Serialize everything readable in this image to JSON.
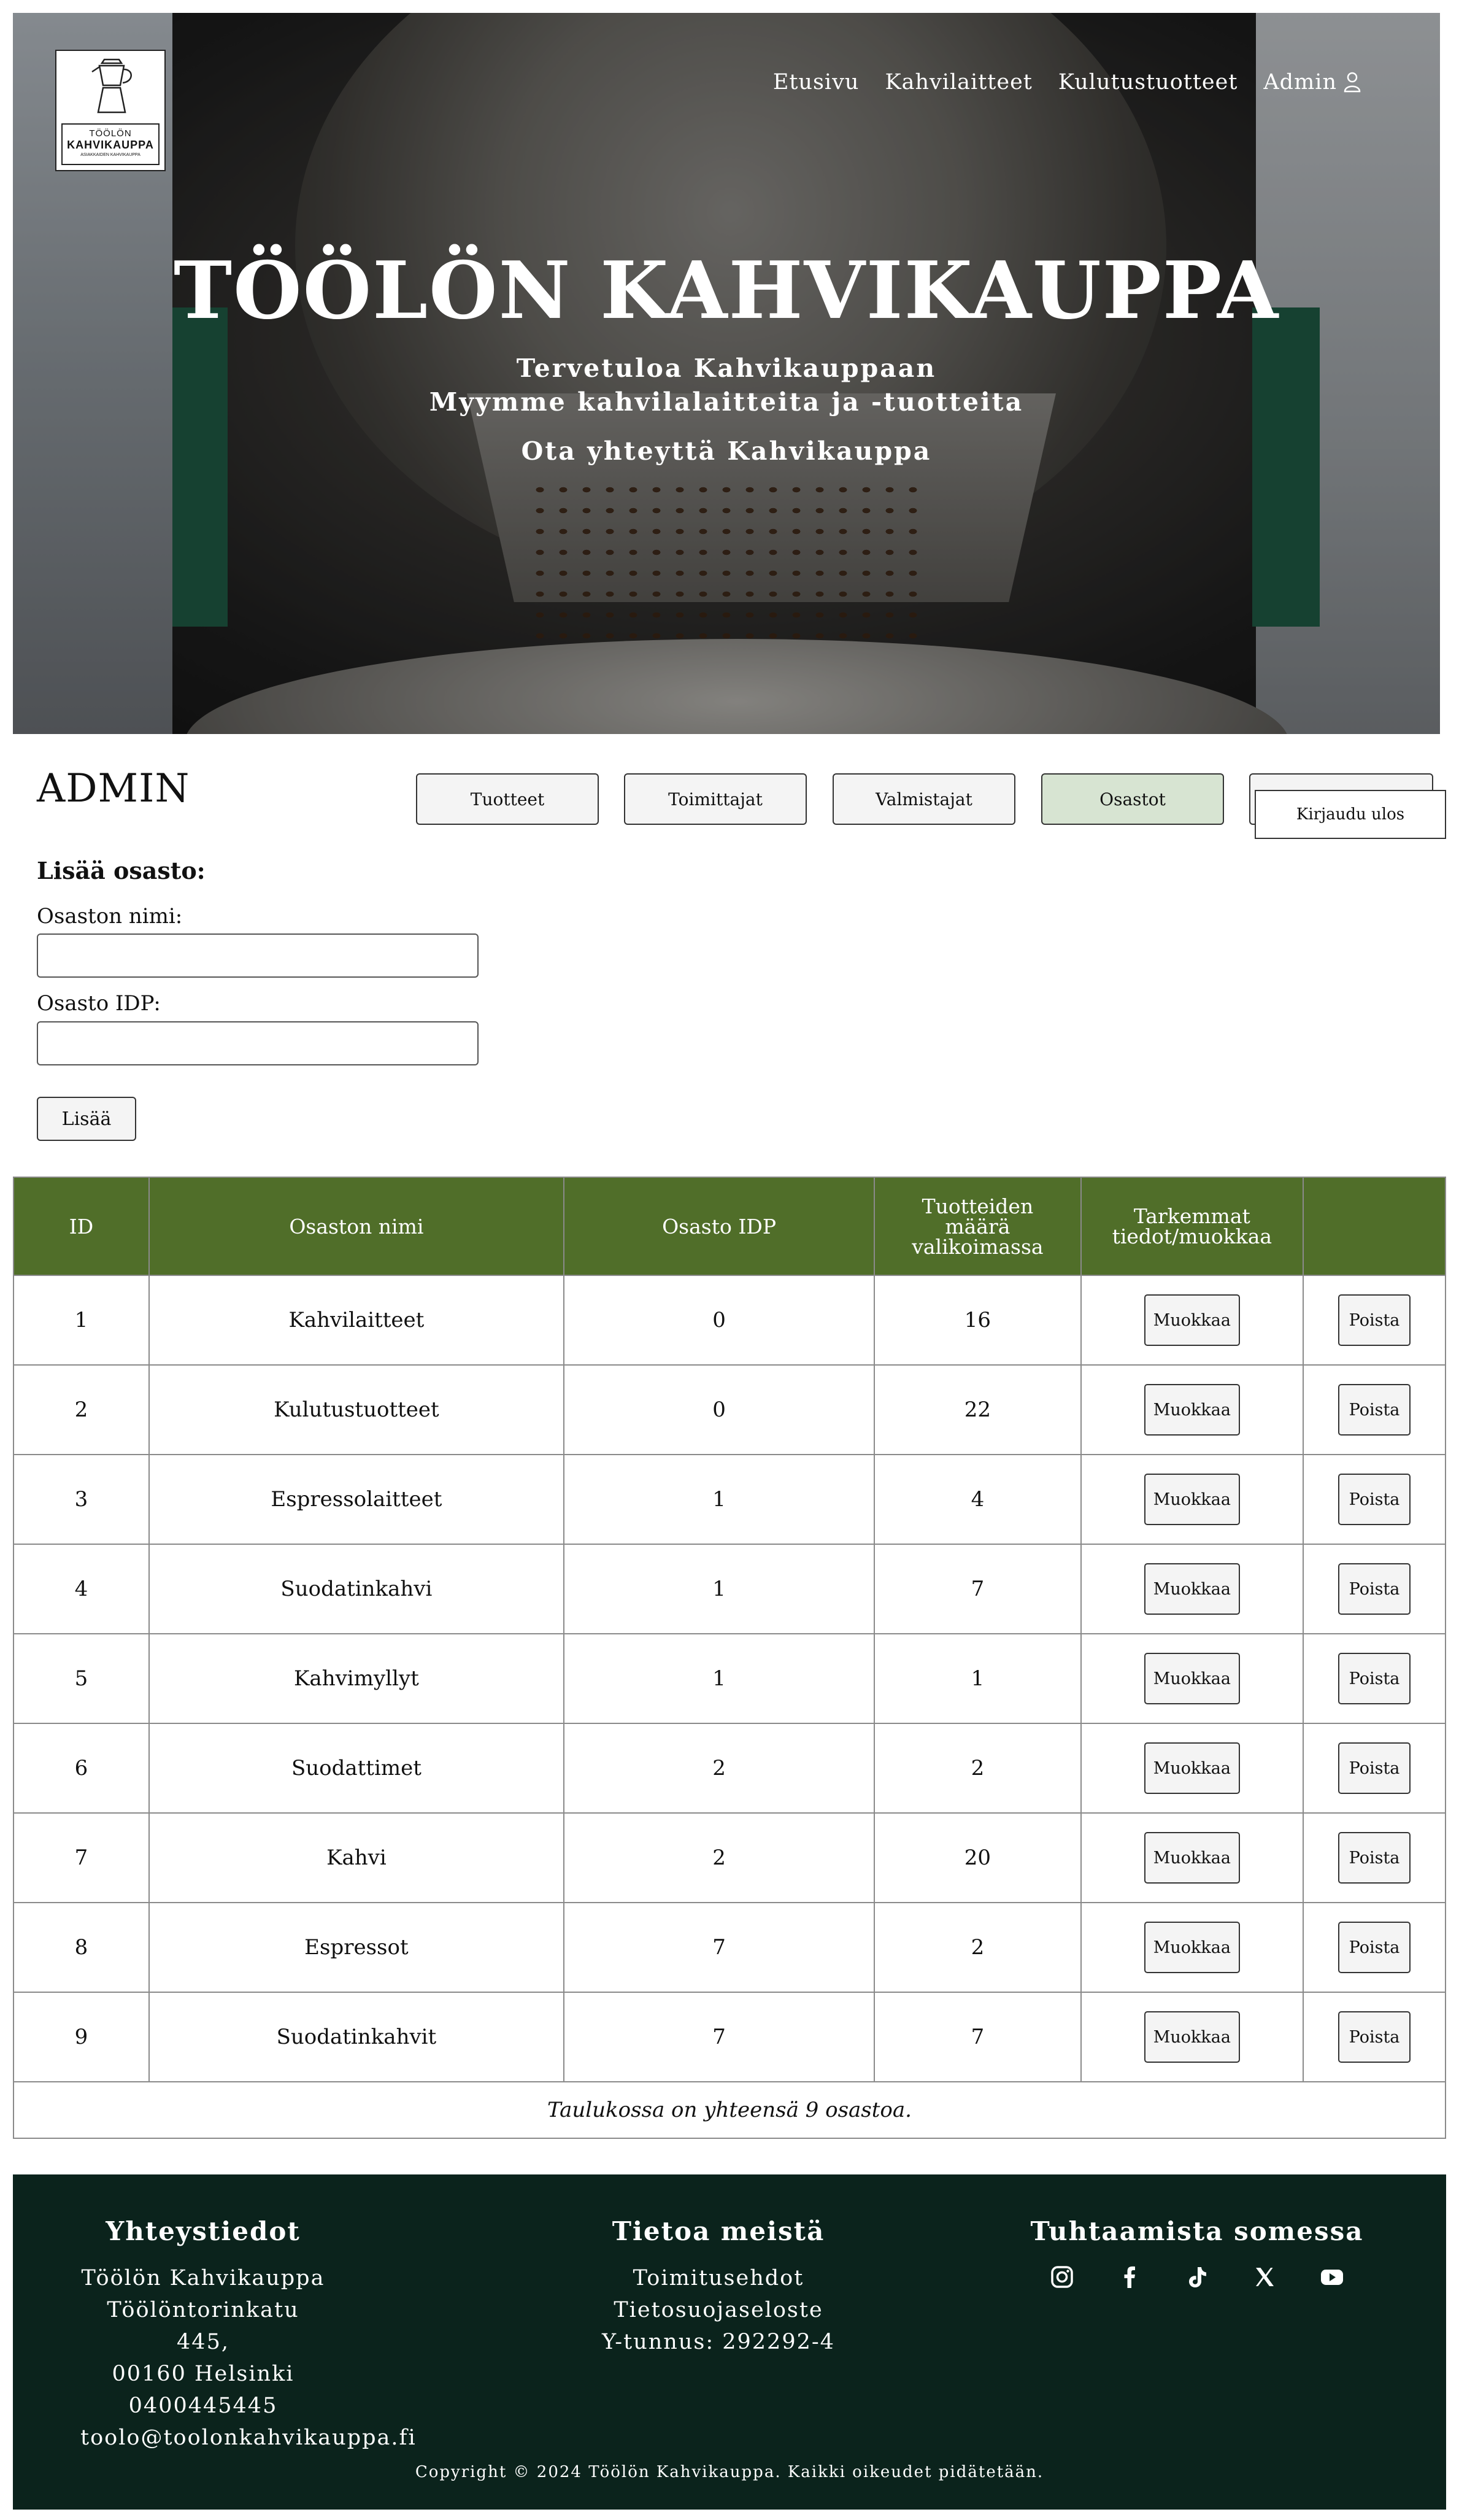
{
  "logo": {
    "line1": "TÖÖLÖN",
    "line2": "KAHVIKAUPPA",
    "line3": "ASIAKKAIDEN KAHVIKAUPPA"
  },
  "nav": {
    "items": [
      "Etusivu",
      "Kahvilaitteet",
      "Kulutustuotteet"
    ],
    "admin": "Admin"
  },
  "hero": {
    "title": "TÖÖLÖN KAHVIKAUPPA",
    "line1": "Tervetuloa Kahvikauppaan",
    "line2": "Myymme kahvilalaitteita ja -tuotteita",
    "line3": "Ota yhteyttä Kahvikauppa"
  },
  "admin": {
    "title": "ADMIN",
    "tabs": [
      "Tuotteet",
      "Toimittajat",
      "Valmistajat",
      "Osastot"
    ],
    "active_tab": "Osastot",
    "logout": "Kirjaudu ulos"
  },
  "form": {
    "heading": "Lisää osasto:",
    "name_label": "Osaston nimi:",
    "name_value": "",
    "idp_label": "Osasto IDP:",
    "idp_value": "",
    "submit": "Lisää"
  },
  "table": {
    "headers": [
      "ID",
      "Osaston nimi",
      "Osasto IDP",
      "Tuotteiden määrä valikoimassa",
      "Tarkemmat tiedot/muokkaa",
      ""
    ],
    "rows": [
      {
        "id": "1",
        "name": "Kahvilaitteet",
        "idp": "0",
        "count": "16"
      },
      {
        "id": "2",
        "name": "Kulutustuotteet",
        "idp": "0",
        "count": "22"
      },
      {
        "id": "3",
        "name": "Espressolaitteet",
        "idp": "1",
        "count": "4"
      },
      {
        "id": "4",
        "name": "Suodatinkahvi",
        "idp": "1",
        "count": "7"
      },
      {
        "id": "5",
        "name": "Kahvimyllyt",
        "idp": "1",
        "count": "1"
      },
      {
        "id": "6",
        "name": "Suodattimet",
        "idp": "2",
        "count": "2"
      },
      {
        "id": "7",
        "name": "Kahvi",
        "idp": "2",
        "count": "20"
      },
      {
        "id": "8",
        "name": "Espressot",
        "idp": "7",
        "count": "2"
      },
      {
        "id": "9",
        "name": "Suodatinkahvit",
        "idp": "7",
        "count": "7"
      }
    ],
    "edit_label": "Muokkaa",
    "delete_label": "Poista",
    "summary": "Taulukossa on yhteensä 9 osastoa."
  },
  "footer": {
    "contact": {
      "title": "Yhteystiedot",
      "lines": [
        "Töölön Kahvikauppa",
        "Töölöntorinkatu 445,",
        "00160 Helsinki",
        "0400445445",
        "toolo@toolonkahvikauppa.fi"
      ]
    },
    "about": {
      "title": "Tietoa meistä",
      "lines": [
        "Toimitusehdot",
        "Tietosuojaseloste",
        "Y-tunnus: 292292-4"
      ]
    },
    "social": {
      "title": "Tuhtaamista somessa",
      "icons": [
        "instagram-icon",
        "facebook-icon",
        "tiktok-icon",
        "x-icon",
        "youtube-icon"
      ]
    },
    "copyright": "Copyright © 2024 Töölön Kahvikauppa. Kaikki oikeudet pidätetään."
  },
  "colors": {
    "table_header": "#506e29",
    "footer_bg": "#0b231c",
    "active_tab": "#d7e4d2"
  }
}
